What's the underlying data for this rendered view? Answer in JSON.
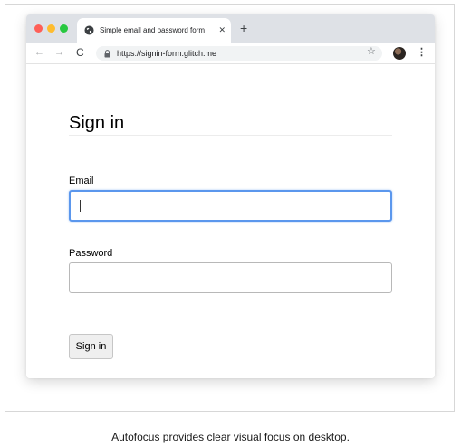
{
  "browser": {
    "tab": {
      "title": "Simple email and password form",
      "close_glyph": "✕",
      "favicon": "globe-icon"
    },
    "new_tab_glyph": "+",
    "nav": {
      "back_glyph": "←",
      "forward_glyph": "→",
      "reload_glyph": "C"
    },
    "url": "https://signin-form.glitch.me",
    "star_glyph": "☆",
    "menu_glyph": "⋮"
  },
  "form": {
    "heading": "Sign in",
    "email_label": "Email",
    "email_value": "",
    "password_label": "Password",
    "password_value": "",
    "submit_label": "Sign in"
  },
  "caption": "Autofocus provides clear visual focus on desktop.",
  "colors": {
    "focus_ring": "#5b97ed",
    "tabstrip": "#dee1e6",
    "traffic_red": "#fe5f57",
    "traffic_yellow": "#febc2e",
    "traffic_green": "#28c840"
  }
}
